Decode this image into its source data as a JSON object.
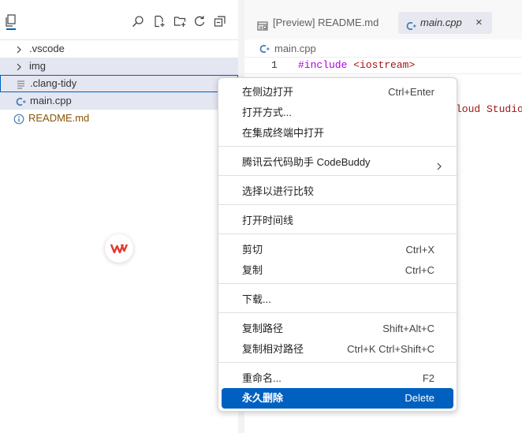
{
  "sidebar": {
    "toolbar_icons": [
      "explorer-icon",
      "search-icon",
      "new-file-icon",
      "new-folder-icon",
      "refresh-icon",
      "collapse-all-icon"
    ],
    "tree": [
      {
        "label": ".vscode",
        "kind": "folder",
        "icon": "chevron-right-icon"
      },
      {
        "label": "img",
        "kind": "folder",
        "icon": "chevron-right-icon"
      },
      {
        "label": ".clang-tidy",
        "kind": "file",
        "icon": "lines-file-icon"
      },
      {
        "label": "main.cpp",
        "kind": "file",
        "icon": "cpp-file-icon"
      },
      {
        "label": "README.md",
        "kind": "file",
        "icon": "info-icon"
      }
    ]
  },
  "editor": {
    "tabs": [
      {
        "label": "[Preview] README.md",
        "icon": "preview-icon"
      },
      {
        "label": "main.cpp",
        "icon": "cpp-file-icon",
        "close": "×"
      }
    ],
    "breadcrumb": "main.cpp",
    "line_number": "1",
    "code_keyword": "#include",
    "code_header": "<iostream>",
    "partial_text": "loud Studio"
  },
  "menu": {
    "items": [
      {
        "label": "在侧边打开",
        "shortcut": "Ctrl+Enter"
      },
      {
        "label": "打开方式...",
        "shortcut": ""
      },
      {
        "label": "在集成终端中打开",
        "shortcut": ""
      },
      {
        "label": "腾讯云代码助手 CodeBuddy",
        "shortcut": ""
      },
      {
        "label": "选择以进行比较",
        "shortcut": ""
      },
      {
        "label": "打开时间线",
        "shortcut": ""
      },
      {
        "label": "剪切",
        "shortcut": "Ctrl+X"
      },
      {
        "label": "复制",
        "shortcut": "Ctrl+C"
      },
      {
        "label": "下载...",
        "shortcut": ""
      },
      {
        "label": "复制路径",
        "shortcut": "Shift+Alt+C"
      },
      {
        "label": "复制相对路径",
        "shortcut": "Ctrl+K Ctrl+Shift+C"
      },
      {
        "label": "重命名...",
        "shortcut": "F2"
      },
      {
        "label": "永久删除",
        "shortcut": "Delete"
      }
    ]
  },
  "colors": {
    "accent": "#0060c0",
    "selection": "#e4e6f1",
    "readme_text": "#895503",
    "keyword": "#af00db",
    "string": "#a31515"
  }
}
